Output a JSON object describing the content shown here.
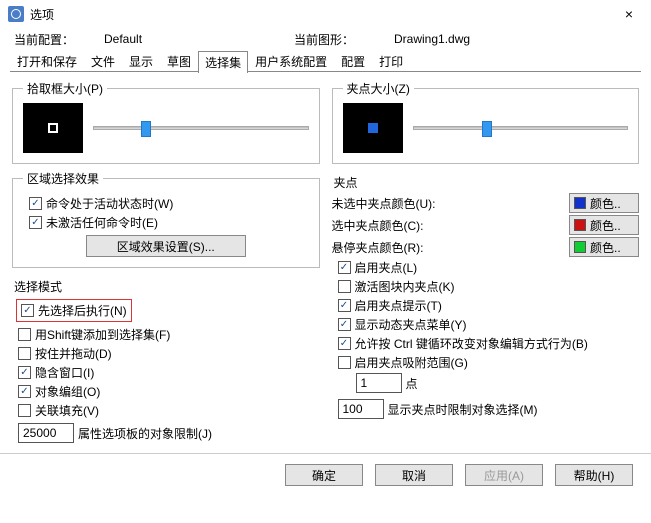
{
  "window": {
    "title": "选项",
    "close": "×"
  },
  "info": {
    "cfg_label": "当前配置：",
    "cfg_value": "Default",
    "dwg_label": "当前图形：",
    "dwg_value": "Drawing1.dwg"
  },
  "tabs": [
    "打开和保存",
    "文件",
    "显示",
    "草图",
    "选择集",
    "用户系统配置",
    "配置",
    "打印"
  ],
  "active_tab": "选择集",
  "left": {
    "pickbox_group": "拾取框大小(P)",
    "region_group": "区域选择效果",
    "region_chk1": "命令处于活动状态时(W)",
    "region_chk2": "未激活任何命令时(E)",
    "region_btn": "区域效果设置(S)...",
    "select_group": "选择模式",
    "sel_chk1": "先选择后执行(N)",
    "sel_chk2": "用Shift键添加到选择集(F)",
    "sel_chk3": "按住并拖动(D)",
    "sel_chk4": "隐含窗口(I)",
    "sel_chk5": "对象编组(O)",
    "sel_chk6": "关联填充(V)",
    "sel_limit_val": "25000",
    "sel_limit_lbl": "属性选项板的对象限制(J)"
  },
  "right": {
    "grip_group": "夹点大小(Z)",
    "grip_section": "夹点",
    "row1_lbl": "未选中夹点颜色(U):",
    "row2_lbl": "选中夹点颜色(C):",
    "row3_lbl": "悬停夹点颜色(R):",
    "color_btn": "颜色..",
    "colors": {
      "unsel": "#1133cc",
      "sel": "#cc1111",
      "hover": "#11cc33"
    },
    "g_chk1": "启用夹点(L)",
    "g_chk2": "激活图块内夹点(K)",
    "g_chk3": "启用夹点提示(T)",
    "g_chk4": "显示动态夹点菜单(Y)",
    "g_chk5": "允许按 Ctrl 键循环改变对象编辑方式行为(B)",
    "g_chk6": "启用夹点吸附范围(G)",
    "g_range_val": "1",
    "g_range_lbl": "点",
    "g_limit_val": "100",
    "g_limit_lbl": "显示夹点时限制对象选择(M)"
  },
  "footer": {
    "ok": "确定",
    "cancel": "取消",
    "apply": "应用(A)",
    "help": "帮助(H)"
  }
}
